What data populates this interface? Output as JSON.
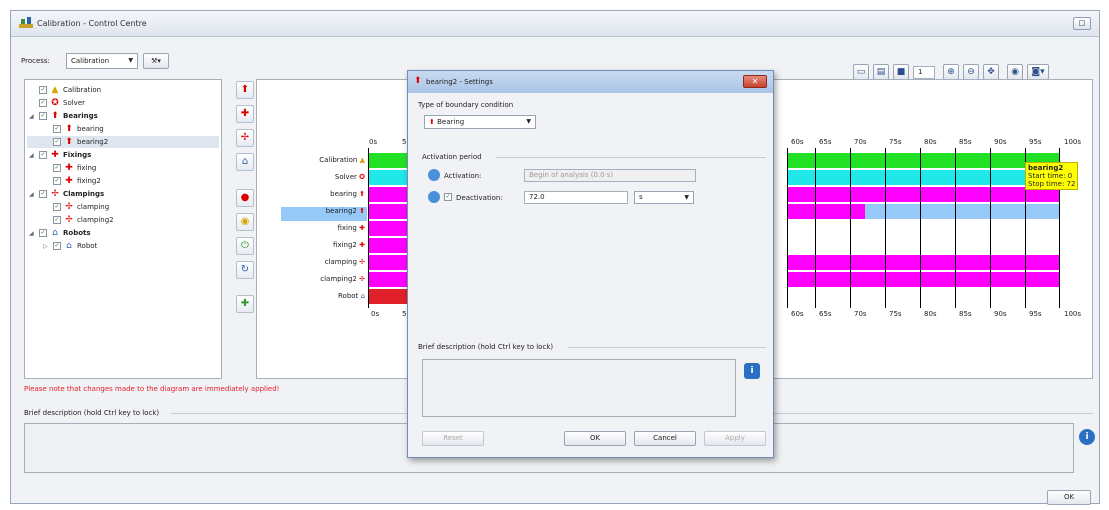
{
  "window": {
    "title": "Calibration - Control Centre",
    "restore_label": "□",
    "ok_label": "OK"
  },
  "toolbar": {
    "process_label": "Process:",
    "process_value": "Calibration",
    "zoom_value": "1"
  },
  "tree": {
    "items": [
      {
        "label": "Calibration",
        "icon": "warning-icon"
      },
      {
        "label": "Solver",
        "icon": "solver-icon"
      },
      {
        "label": "Bearings",
        "icon": "bearing-icon"
      },
      {
        "label": "bearing",
        "icon": "bearing-icon"
      },
      {
        "label": "bearing2",
        "icon": "bearing-icon"
      },
      {
        "label": "Fixings",
        "icon": "fixing-icon"
      },
      {
        "label": "fixing",
        "icon": "fixing-icon"
      },
      {
        "label": "fixing2",
        "icon": "fixing-icon"
      },
      {
        "label": "Clampings",
        "icon": "clamping-icon"
      },
      {
        "label": "clamping",
        "icon": "clamping-icon"
      },
      {
        "label": "clamping2",
        "icon": "clamping-icon"
      },
      {
        "label": "Robots",
        "icon": "robot-icon"
      },
      {
        "label": "Robot",
        "icon": "robot-icon"
      }
    ]
  },
  "gantt": {
    "rows": [
      "Calibration",
      "Solver",
      "bearing",
      "bearing2",
      "fixing",
      "fixing2",
      "clamping",
      "clamping2",
      "Robot"
    ],
    "ticks_left": [
      "0s",
      "5"
    ],
    "ticks_right": [
      "60s",
      "65s",
      "70s",
      "75s",
      "80s",
      "85s",
      "90s",
      "95s",
      "100s"
    ],
    "colors": {
      "calibration": "#22e026",
      "solver": "#20e8e8",
      "magenta": "#ff00ff",
      "light_blue": "#96c8f8",
      "robot": "#e0202a",
      "tooltip": "#ffff00"
    },
    "tooltip": {
      "title": "bearing2",
      "start": "Start time: 0",
      "stop": "Stop time: 72"
    }
  },
  "note": "Please note that changes made to the diagram are immediately applied!",
  "brief_label": "Brief description (hold Ctrl key to lock)",
  "dialog": {
    "title": "bearing2 - Settings",
    "type_label": "Type of boundary condition",
    "type_value": "Bearing",
    "activation_group": "Activation period",
    "activation_label": "Activation:",
    "activation_value": "Begin of analysis (0.0 s)",
    "deactivation_label": "Deactivation:",
    "deactivation_value": "72.0",
    "deactivation_unit": "s",
    "brief_label": "Brief description (hold Ctrl key to lock)",
    "reset_label": "Reset",
    "ok_label": "OK",
    "cancel_label": "Cancel",
    "apply_label": "Apply"
  }
}
